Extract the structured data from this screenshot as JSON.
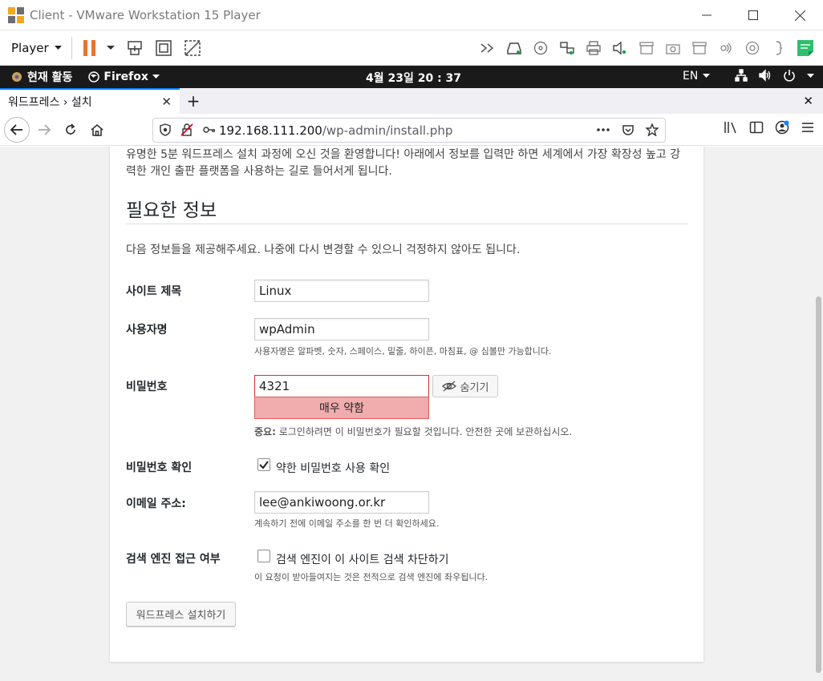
{
  "vmware": {
    "window_title": "Client - VMware Workstation 15 Player",
    "player_menu": "Player"
  },
  "gnome": {
    "activities": "현재 활동",
    "app": "Firefox",
    "clock": "4월 23일  20 : 37",
    "lang": "EN"
  },
  "browser": {
    "tab_title": "워드프레스 › 설치",
    "url_host": "192.168.111.200",
    "url_path": "/wp-admin/install.php"
  },
  "page": {
    "intro": "유명한 5분 워드프레스 설치 과정에 오신 것을 환영합니다! 아래에서 정보를 입력만 하면 세계에서 가장 확장성 높고 강력한 개인 출판 플랫폼을 사용하는 길로 들어서게 됩니다.",
    "section_title": "필요한 정보",
    "description": "다음 정보들을 제공해주세요. 나중에 다시 변경할 수 있으니 걱정하지 않아도 됩니다.",
    "site_title": {
      "label": "사이트 제목",
      "value": "Linux"
    },
    "username": {
      "label": "사용자명",
      "value": "wpAdmin",
      "help": "사용자명은 알파벳, 숫자, 스페이스, 밑줄, 하이픈, 마침표, @ 심볼만 가능합니다."
    },
    "password": {
      "label": "비밀번호",
      "value": "4321",
      "hide_button": "숨기기",
      "strength": "매우 약함",
      "note_bold": "중요:",
      "note": " 로그인하려면 이 비밀번호가 필요할 것입니다. 안전한 곳에 보관하십시오."
    },
    "confirm": {
      "label": "비밀번호 확인",
      "checkbox_label": "약한 비밀번호 사용 확인",
      "checked": true
    },
    "email": {
      "label": "이메일 주소:",
      "value": "lee@ankiwoong.or.kr",
      "help": "계속하기 전에 이메일 주소를 한 번 더 확인하세요."
    },
    "search": {
      "label": "검색 엔진 접근 여부",
      "checkbox_label": "검색 엔진이 이 사이트 검색 차단하기",
      "checked": false,
      "help": "이 요청이 받아들여지는 것은 전적으로 검색 엔진에 좌우됩니다."
    },
    "submit": "워드프레스 설치하기"
  },
  "colors": {
    "strength_bg": "#f1adad",
    "vmware_pause": "#e8742f",
    "firefox_accent": "#0a84ff"
  }
}
